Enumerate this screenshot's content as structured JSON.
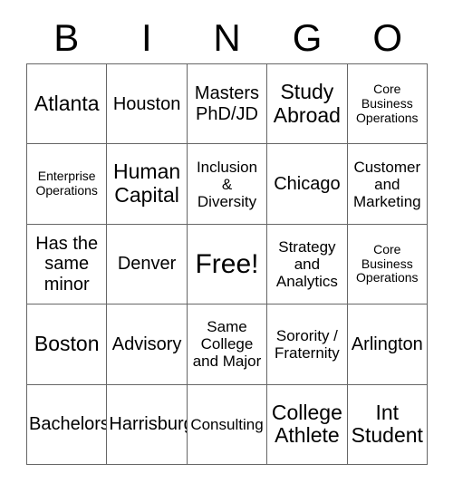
{
  "card": {
    "title": "BINGO",
    "header_letters": [
      "B",
      "I",
      "N",
      "G",
      "O"
    ],
    "columns": 5,
    "rows": 5,
    "free_space": {
      "row": 3,
      "column": 3,
      "label": "Free!"
    },
    "colors": {
      "text": "#000000",
      "grid_line": "#666666",
      "background": "#ffffff"
    }
  },
  "grid": {
    "rows": [
      [
        {
          "text": "Atlanta",
          "size": "lg"
        },
        {
          "text": "Houston",
          "size": "md"
        },
        {
          "text": "Masters\nPhD/JD",
          "size": "md"
        },
        {
          "text": "Study\nAbroad",
          "size": "lg"
        },
        {
          "text": "Core\nBusiness\nOperations",
          "size": "xs"
        }
      ],
      [
        {
          "text": "Enterprise\nOperations",
          "size": "xs"
        },
        {
          "text": "Human\nCapital",
          "size": "lg"
        },
        {
          "text": "Inclusion\n&\nDiversity",
          "size": "sm"
        },
        {
          "text": "Chicago",
          "size": "md"
        },
        {
          "text": "Customer\nand\nMarketing",
          "size": "sm"
        }
      ],
      [
        {
          "text": "Has the\nsame\nminor",
          "size": "md"
        },
        {
          "text": "Denver",
          "size": "md"
        },
        {
          "text": "Free!",
          "size": "free"
        },
        {
          "text": "Strategy\nand\nAnalytics",
          "size": "sm"
        },
        {
          "text": "Core\nBusiness\nOperations",
          "size": "xs"
        }
      ],
      [
        {
          "text": "Boston",
          "size": "lg"
        },
        {
          "text": "Advisory",
          "size": "md"
        },
        {
          "text": "Same\nCollege\nand Major",
          "size": "sm"
        },
        {
          "text": "Sorority /\nFraternity",
          "size": "sm"
        },
        {
          "text": "Arlington",
          "size": "md"
        }
      ],
      [
        {
          "text": "Bachelors",
          "size": "md"
        },
        {
          "text": "Harrisburg",
          "size": "md"
        },
        {
          "text": "Consulting",
          "size": "sm"
        },
        {
          "text": "College\nAthlete",
          "size": "lg"
        },
        {
          "text": "Int\nStudent",
          "size": "lg"
        }
      ]
    ]
  }
}
